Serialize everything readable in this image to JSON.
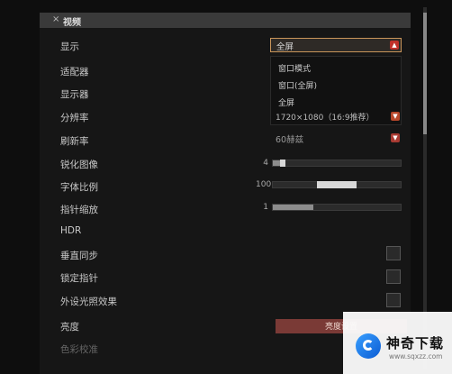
{
  "panel": {
    "close_glyph": "×",
    "title": "视频"
  },
  "rows": [
    {
      "label": "显示"
    },
    {
      "label": "适配器"
    },
    {
      "label": "显示器"
    },
    {
      "label": "分辨率"
    },
    {
      "label": "刷新率"
    },
    {
      "label": "锐化图像"
    },
    {
      "label": "字体比例"
    },
    {
      "label": "指针缩放"
    },
    {
      "label": "HDR"
    },
    {
      "label": "垂直同步"
    },
    {
      "label": "锁定指针"
    },
    {
      "label": "外设光照效果"
    },
    {
      "label": "亮度"
    },
    {
      "label": "色彩校准"
    }
  ],
  "display_dropdown": {
    "value": "全屏",
    "options": [
      "窗口模式",
      "窗口(全屏)",
      "全屏"
    ]
  },
  "resolution": {
    "value": "1720×1080（16:9推荐）"
  },
  "refresh": {
    "value": "60赫兹"
  },
  "sharpen": {
    "number": "4",
    "level": 0.08
  },
  "font_scale": {
    "number": "100",
    "level": 0.5
  },
  "pointer_scale": {
    "number": "1",
    "level": 0.32
  },
  "apply": {
    "label": "亮度设置"
  },
  "watermark": {
    "name": "神奇下载",
    "url": "www.sqxzz.com"
  },
  "colors": {
    "accent": "#c0302a",
    "background": "#161616",
    "header": "#3a3a3a"
  },
  "icons": [
    "close-icon",
    "chevron-up-icon",
    "chevron-down-icon",
    "logo-icon"
  ]
}
